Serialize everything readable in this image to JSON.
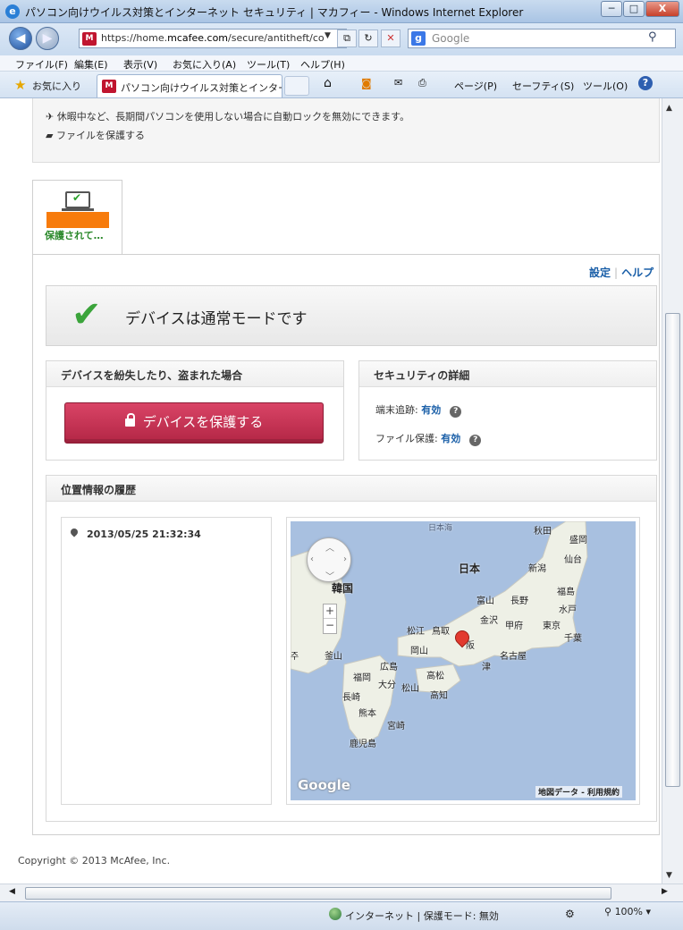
{
  "window": {
    "title": "パソコン向けウイルス対策とインターネット セキュリティ | マカフィー - Windows Internet Explorer",
    "controls": {
      "minimize": "─",
      "maximize": "□",
      "close": "X"
    }
  },
  "addressbar": {
    "url_prefix": "https://home.",
    "url_domain": "mcafee.com",
    "url_suffix": "/secure/antitheft/cor",
    "search_placeholder": "Google",
    "refresh": "↻",
    "stop": "✕"
  },
  "menubar": [
    "ファイル(F)",
    "編集(E)",
    "表示(V)",
    "お気に入り(A)",
    "ツール(T)",
    "ヘルプ(H)"
  ],
  "favorites": {
    "label": "お気に入り",
    "tab_title": "パソコン向けウイルス対策とインター..."
  },
  "commandbar": [
    "ページ(P)",
    "セーフティ(S)",
    "ツール(O)"
  ],
  "content": {
    "top_items": [
      "休暇中など、長期間パソコンを使用しない場合に自動ロックを無効にできます。",
      "ファイルを保護する"
    ],
    "device_tab_status": "保護されて…",
    "links": {
      "settings": "設定",
      "help": "ヘルプ"
    },
    "normal_mode": "デバイスは通常モードです",
    "lost_panel": {
      "title": "デバイスを紛失したり、盗まれた場合",
      "button": "デバイスを保護する"
    },
    "security_panel": {
      "title": "セキュリティの詳細",
      "tracking_label": "端末追跡:",
      "tracking_value": "有効",
      "file_label": "ファイル保護:",
      "file_value": "有効"
    },
    "history_panel": {
      "title": "位置情報の履歴",
      "timestamp": "2013/05/25 21:32:34"
    },
    "map": {
      "labels": {
        "japan_sea": "日本海",
        "japan": "日本",
        "korea": "韓国",
        "akita": "秋田",
        "morioka": "盛岡",
        "sendai": "仙台",
        "niigata": "新潟",
        "fukushima": "福島",
        "toyama": "富山",
        "nagano": "長野",
        "mito": "水戸",
        "kanazawa": "金沢",
        "kofu": "甲府",
        "tokyo": "東京",
        "chiba": "千葉",
        "matsue": "松江",
        "tottori": "鳥取",
        "okayama": "岡山",
        "nagoya": "名古屋",
        "tsu": "津",
        "busan": "釜山",
        "hiroshima": "広島",
        "takamatsu": "高松",
        "fukuoka": "福岡",
        "oita": "大分",
        "matsuyama": "松山",
        "nagasaki": "長崎",
        "kochi": "高知",
        "kumamoto": "熊本",
        "miyazaki": "宮崎",
        "kagoshima": "鹿児島",
        "kyoto_partial": "阪",
        "jeonju_partial": "주",
        "google": "Google",
        "data": "地図データ - 利用規約"
      },
      "zoom_in": "+",
      "zoom_out": "−"
    },
    "copyright": "Copyright © 2013 McAfee, Inc."
  },
  "statusbar": {
    "zone": "インターネット | 保護モード: 無効",
    "zoom": "100%"
  }
}
